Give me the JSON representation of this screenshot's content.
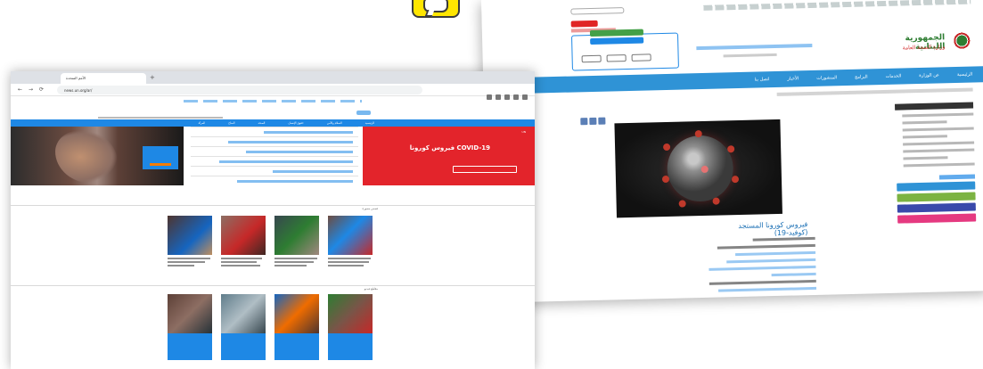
{
  "chat_icon": {
    "name": "chat-bubble-icon",
    "color": "#ffe600"
  },
  "right_window": {
    "language": "Arabic",
    "ministry_name_line1": "الجمهورية اللبنانية",
    "ministry_name_line2": "وزارة الصحة العامة",
    "nav_items": [
      "الرئيسية",
      "عن الوزارة",
      "الخدمات",
      "البرامج",
      "المنشورات",
      "الأخبار",
      "اتصل بنا"
    ],
    "sidebar_pills": [
      {
        "color": "#2f93d6"
      },
      {
        "color": "#7cb342"
      },
      {
        "color": "#3949ab"
      },
      {
        "color": "#e53980"
      }
    ],
    "article_title": "فيروس كورونا المستجد (كوفيد-19)",
    "accent_color": "#2f93d6"
  },
  "left_window": {
    "tab_title": "الأمم المتحدة",
    "url": "news.un.org/ar/",
    "hero_tag": "UN",
    "hero_title": "فيروس كورونا COVID-19",
    "hero_color": "#e3242b",
    "nav_items": [
      "الرئيسية",
      "السلام والأمن",
      "حقوق الإنسان",
      "الصحة",
      "المناخ",
      "المرأة"
    ],
    "section_label_1": "قصص مصورة",
    "section_label_2": "مقاطع فيديو",
    "accent_color": "#1e88e5"
  }
}
